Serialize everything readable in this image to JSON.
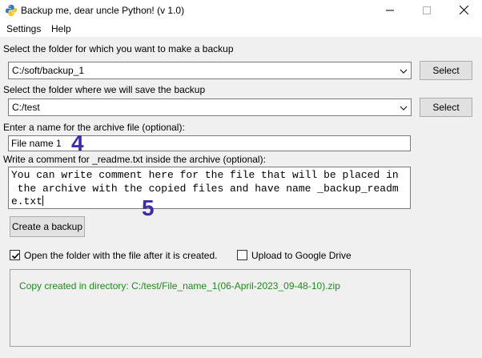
{
  "window": {
    "title": "Backup me, dear uncle Python! (v 1.0)",
    "icon": "python-icon"
  },
  "menu": {
    "settings": "Settings",
    "help": "Help"
  },
  "source": {
    "label": "Select the folder for which you want to make a backup",
    "value": "C:/soft/backup_1",
    "button": "Select"
  },
  "destination": {
    "label": "Select the folder where we will save the backup",
    "value": "C:/test",
    "button": "Select"
  },
  "archive_name": {
    "label": "Enter a name for the archive file (optional):",
    "value": "File name 1"
  },
  "comment": {
    "label": "Write a comment for _readme.txt inside the archive (optional):",
    "lines": [
      "You can write comment here for the file that will be placed in",
      " the archive with the copied files and have name _backup_readm",
      "e.txt"
    ]
  },
  "annotations": {
    "marker_1": "4",
    "marker_2": "5",
    "color": "#3a2ea8"
  },
  "actions": {
    "create_backup": "Create a backup"
  },
  "options": {
    "open_folder": {
      "label": "Open the folder with the file after it is created.",
      "checked": true
    },
    "upload_drive": {
      "label": "Upload to Google Drive",
      "checked": false
    }
  },
  "status": {
    "message": "Copy created in directory: C:/test/File_name_1(06-April-2023_09-48-10).zip",
    "color": "#1e8b1e"
  }
}
